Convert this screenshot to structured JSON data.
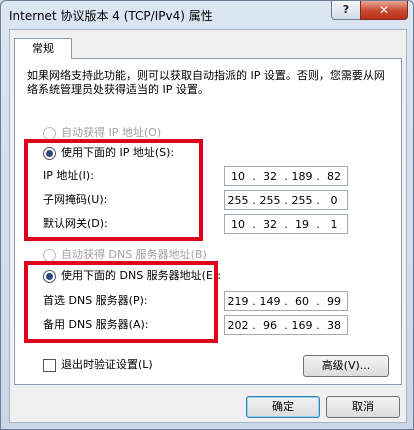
{
  "window": {
    "title": "Internet 协议版本 4 (TCP/IPv4) 属性",
    "help_glyph": "?",
    "close_glyph": "✕"
  },
  "tabs": [
    {
      "label": "常规"
    }
  ],
  "description": "如果网络支持此功能，则可以获取自动指派的 IP 设置。否则，您需要从网络系统管理员处获得适当的 IP 设置。",
  "ip": {
    "auto_label": "自动获得 IP 地址(O)",
    "manual_label": "使用下面的 IP 地址(S):",
    "fields": [
      {
        "label": "IP 地址(I):",
        "octets": [
          "10",
          "32",
          "189",
          "82"
        ]
      },
      {
        "label": "子网掩码(U):",
        "octets": [
          "255",
          "255",
          "255",
          "0"
        ]
      },
      {
        "label": "默认网关(D):",
        "octets": [
          "10",
          "32",
          "19",
          "1"
        ]
      }
    ]
  },
  "dns": {
    "auto_label": "自动获得 DNS 服务器地址(B)",
    "manual_label": "使用下面的 DNS 服务器地址(E):",
    "fields": [
      {
        "label": "首选 DNS 服务器(P):",
        "octets": [
          "219",
          "149",
          "60",
          "99"
        ]
      },
      {
        "label": "备用 DNS 服务器(A):",
        "octets": [
          "202",
          "96",
          "169",
          "38"
        ]
      }
    ]
  },
  "validate_label": "退出时验证设置(L)",
  "advanced_label": "高级(V)...",
  "ok_label": "确定",
  "cancel_label": "取消",
  "colors": {
    "highlight_box": "#e0001a",
    "selected_radio": "#2b4b7d"
  }
}
